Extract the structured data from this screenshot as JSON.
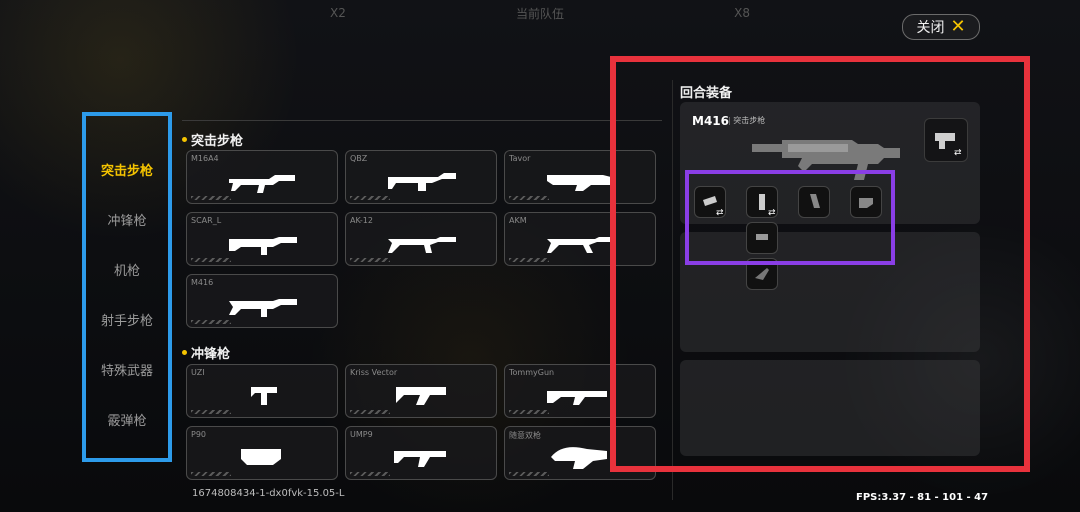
{
  "top": {
    "left_badge": "X2",
    "center_text": "当前队伍",
    "right_badge": "X8"
  },
  "close": {
    "label": "关闭"
  },
  "nav": {
    "items": [
      {
        "label": "突击步枪",
        "active": true
      },
      {
        "label": "冲锋枪",
        "active": false
      },
      {
        "label": "机枪",
        "active": false
      },
      {
        "label": "射手步枪",
        "active": false
      },
      {
        "label": "特殊武器",
        "active": false
      },
      {
        "label": "霰弹枪",
        "active": false
      }
    ]
  },
  "sections": [
    {
      "title": "突击步枪",
      "weapons": [
        "M16A4",
        "QBZ",
        "Tavor",
        "SCAR_L",
        "AK-12",
        "AKM",
        "M416"
      ]
    },
    {
      "title": "冲锋枪",
      "weapons": [
        "UZI",
        "Kriss Vector",
        "TommyGun",
        "P90",
        "UMP9",
        "随意双枪"
      ]
    }
  ],
  "footer_id": "1674808434-1-dx0fvk-15.05-L",
  "loadout": {
    "title": "回合装备",
    "weapon_name": "M416",
    "weapon_category": "突击步枪"
  },
  "fps": "FPS:3.37 - 81 - 101 - 47",
  "colors": {
    "accent": "#f5c400",
    "blue_box": "#2d9bea",
    "red_box": "#e8323c",
    "purple_box": "#8a3ee6"
  }
}
